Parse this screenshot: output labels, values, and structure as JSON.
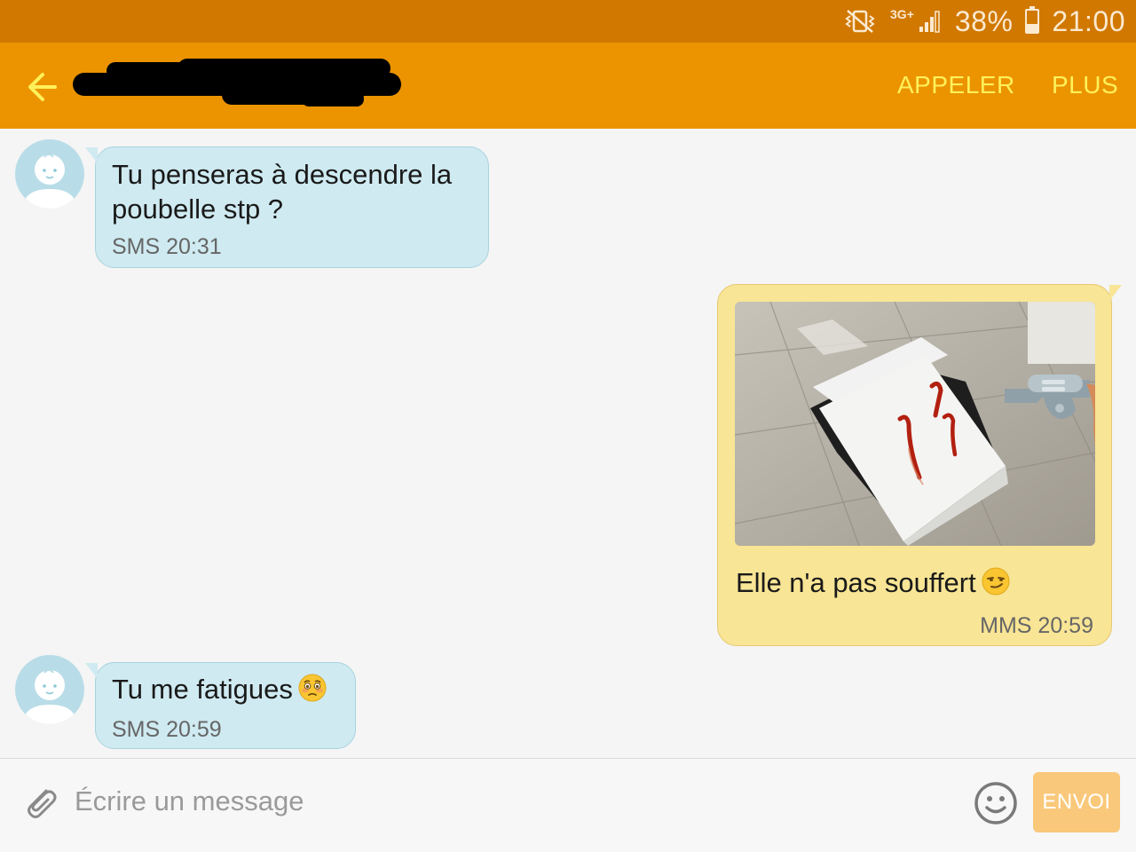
{
  "status_bar": {
    "network": "3G+",
    "battery_text": "38%",
    "battery_level": 0.38,
    "time": "21:00",
    "icons": [
      "vibrate-mute-icon",
      "network-3g-icon",
      "signal-icon",
      "battery-icon"
    ]
  },
  "header": {
    "back_icon": "arrow-left-icon",
    "call_label": "APPELER",
    "more_label": "PLUS",
    "accent_color": "#eb9400",
    "action_color": "#fff15a"
  },
  "messages": [
    {
      "direction": "incoming",
      "lines": [
        "Tu penseras à descendre la",
        "poubelle stp ?"
      ],
      "meta": "SMS 20:31"
    },
    {
      "direction": "outgoing",
      "has_image": true,
      "text": "Elle n'a pas souffert",
      "emoji": "smirking-face-emoji",
      "meta": "MMS 20:59"
    },
    {
      "direction": "incoming",
      "text": "Tu me fatigues",
      "emoji": "flushed-face-emoji",
      "meta": "SMS 20:59"
    }
  ],
  "composer": {
    "placeholder": "Écrire un message",
    "send_label": "ENVOI",
    "attach_icon": "paperclip-icon",
    "emoji_icon": "smiley-icon"
  }
}
